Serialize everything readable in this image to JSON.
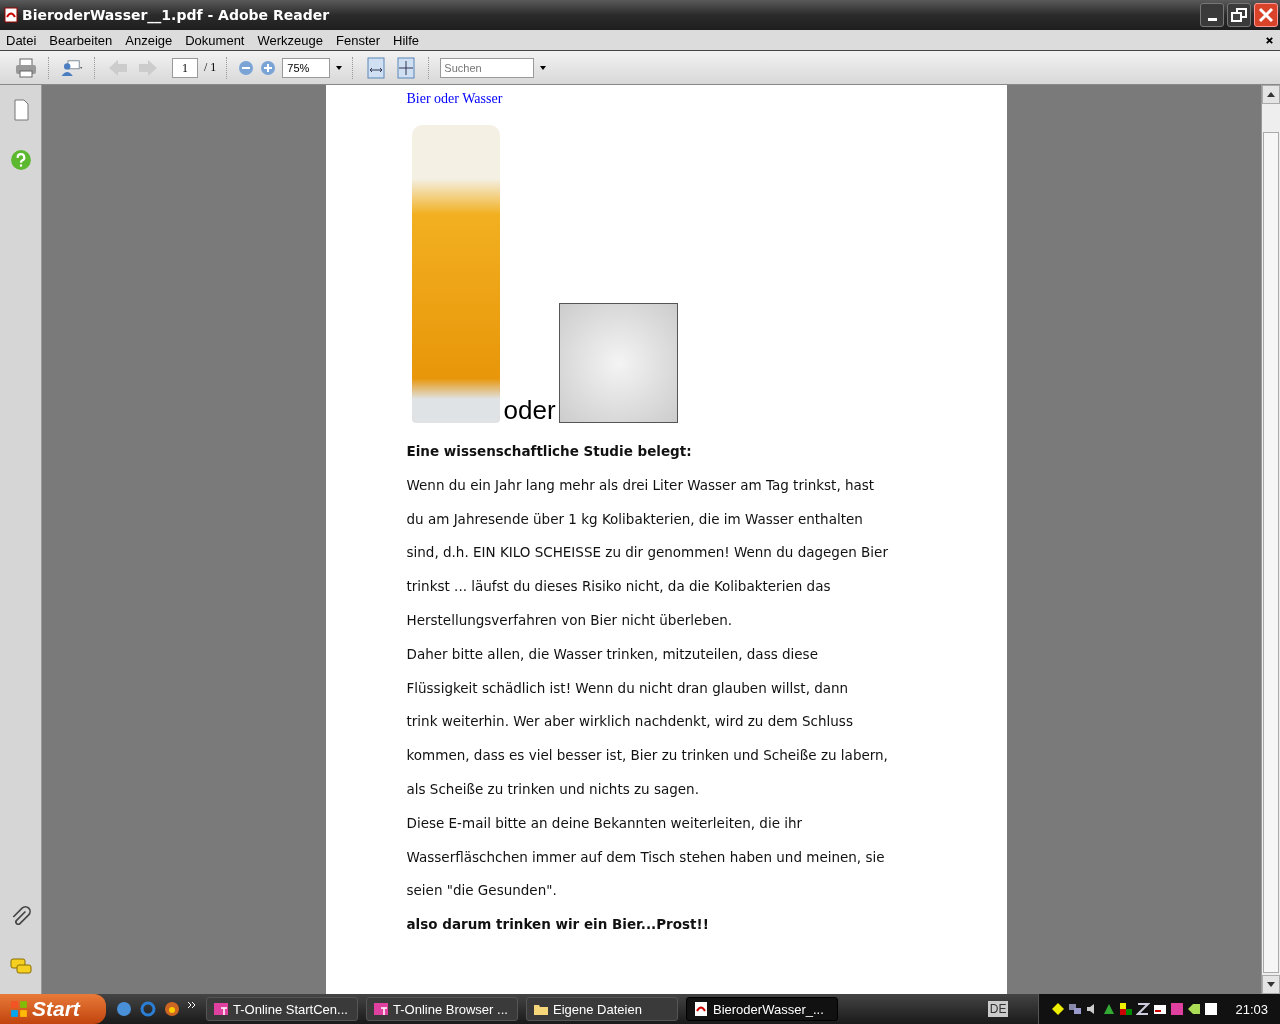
{
  "window": {
    "title": "BieroderWasser__1.pdf - Adobe Reader"
  },
  "menu": [
    "Datei",
    "Bearbeiten",
    "Anzeige",
    "Dokument",
    "Werkzeuge",
    "Fenster",
    "Hilfe"
  ],
  "toolbar": {
    "page_number": "1",
    "page_total": "/ 1",
    "zoom": "75%",
    "search": {
      "placeholder": "Suchen"
    }
  },
  "document": {
    "link": "Bier oder Wasser",
    "caption": "oder",
    "heading": "Eine wissenschaftliche Studie belegt:",
    "lines": [
      "Wenn du ein Jahr lang mehr als drei Liter Wasser am Tag trinkst, hast",
      "du am Jahresende über 1 kg Kolibakterien, die im Wasser enthalten",
      "sind, d.h. EIN KILO SCHEISSE zu dir genommen! Wenn du dagegen Bier",
      "trinkst ... läufst du dieses Risiko nicht, da die Kolibakterien das",
      "Herstellungsverfahren von Bier nicht überleben.",
      "Daher bitte allen, die Wasser trinken, mitzuteilen, dass diese",
      "Flüssigkeit schädlich ist! Wenn du nicht dran glauben willst, dann",
      "trink weiterhin. Wer aber wirklich nachdenkt, wird zu dem Schluss",
      "kommen, dass es viel besser ist, Bier zu trinken und Scheiße zu labern,",
      "als Scheiße zu trinken und nichts zu sagen.",
      "Diese E-mail bitte an deine Bekannten weiterleiten, die ihr",
      "Wasserfläschchen immer auf dem Tisch stehen haben und meinen, sie",
      "seien \"die Gesunden\"."
    ],
    "closing": "also darum trinken wir ein Bier...Prost!!"
  },
  "taskbar": {
    "start": "Start",
    "tasks": [
      {
        "label": "T-Online StartCen...",
        "kind": "tonline",
        "selected": false
      },
      {
        "label": "T-Online Browser ...",
        "kind": "tonline",
        "selected": false
      },
      {
        "label": "Eigene Dateien",
        "kind": "folder",
        "selected": false
      },
      {
        "label": "BieroderWasser_...",
        "kind": "pdf",
        "selected": true
      }
    ],
    "language": "DE",
    "clock": "21:03"
  }
}
